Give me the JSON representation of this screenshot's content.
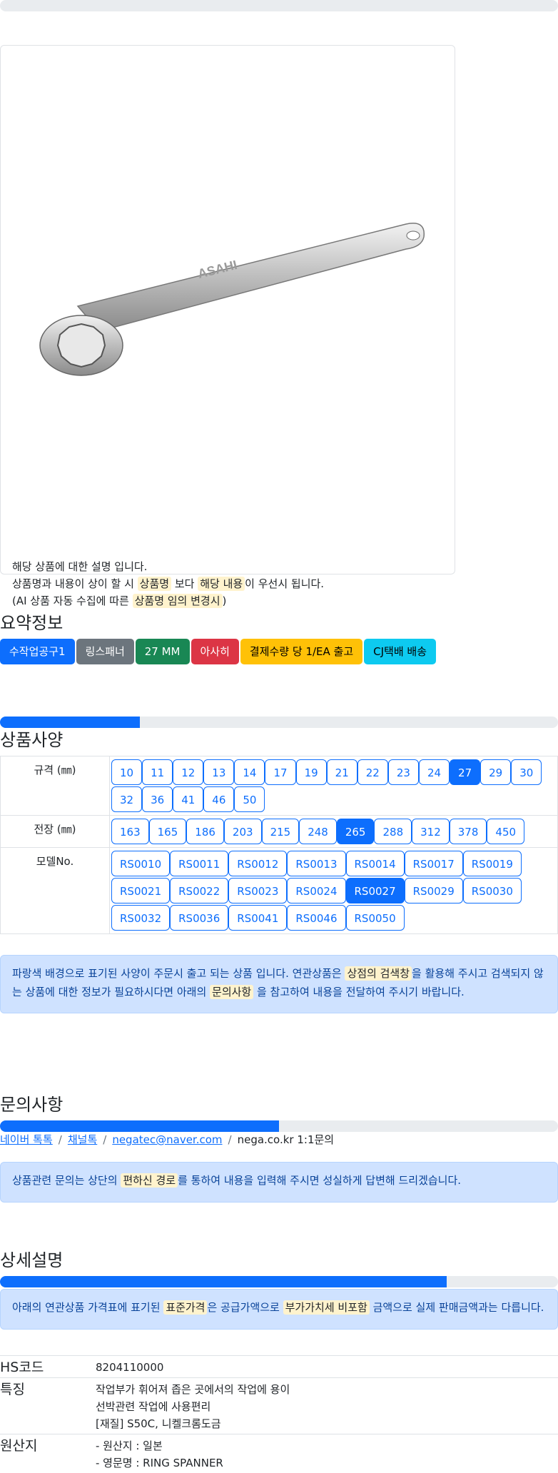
{
  "top_progress_percent": 0,
  "product_card": {
    "image_name": "ring spanner (ASAHI)",
    "brand_mark": "ASAHI",
    "desc_line1": "해당 상품에 대한 설명 입니다.",
    "desc_line2_a": "상품명과 내용이 상이 할 시 ",
    "desc_line2_mark1": "상품명",
    "desc_line2_b": " 보다 ",
    "desc_line2_mark2": "해당 내용",
    "desc_line2_c": "이 우선시 됩니다.",
    "desc_line3_a": "(AI 상품 자동 수집에 따른 ",
    "desc_line3_mark": "상품명 임의 변경시",
    "desc_line3_b": ")"
  },
  "summary": {
    "title": "요약정보",
    "badges": [
      "수작업공구1",
      "링스패너",
      "27 MM",
      "아사히",
      "결제수량 당 1/EA 출고",
      "CJ택배 배송"
    ]
  },
  "spec": {
    "title": "상품사양",
    "progress_percent": 25,
    "rows": [
      {
        "label": "규격 (㎜)",
        "selected": "27",
        "options": [
          "10",
          "11",
          "12",
          "13",
          "14",
          "17",
          "19",
          "21",
          "22",
          "23",
          "24",
          "27",
          "29",
          "30",
          "32",
          "36",
          "41",
          "46",
          "50"
        ]
      },
      {
        "label": "전장 (㎜)",
        "selected": "265",
        "options": [
          "163",
          "165",
          "186",
          "203",
          "215",
          "248",
          "265",
          "288",
          "312",
          "378",
          "450"
        ]
      },
      {
        "label": "모델No.",
        "selected": "RS0027",
        "options": [
          "RS0010",
          "RS0011",
          "RS0012",
          "RS0013",
          "RS0014",
          "RS0017",
          "RS0019",
          "RS0021",
          "RS0022",
          "RS0023",
          "RS0024",
          "RS0027",
          "RS0029",
          "RS0030",
          "RS0032",
          "RS0036",
          "RS0041",
          "RS0046",
          "RS0050"
        ]
      }
    ],
    "notice_a": "파랑색 배경으로 표기된 사양이 주문시 출고 되는 상품 입니다. 연관상품은 ",
    "notice_mark1": "상점의 검색창",
    "notice_b": "을 활용해 주시고 검색되지 않는 상품에 대한 정보가 필요하시다면 아래의 ",
    "notice_mark2": "문의사항",
    "notice_c": " 을 참고하여 내용을 전달하여 주시기 바랍니다."
  },
  "inquiry": {
    "title": "문의사항",
    "progress_percent": 50,
    "links": [
      "네이버 톡톡",
      "채널톡",
      "negatec@naver.com"
    ],
    "plain": "nega.co.kr 1:1문의",
    "separator": "/",
    "notice_a": "상품관련 문의는 상단의 ",
    "notice_mark": "편하신 경로",
    "notice_b": "를 통하여 내용을 입력해 주시면 성실하게 답변해 드리겠습니다."
  },
  "detail": {
    "title": "상세설명",
    "progress_percent": 80,
    "notice_a": "아래의 연관상품 가격표에 표기된 ",
    "notice_mark1": "표준가격",
    "notice_b": "은 공급가액으로 ",
    "notice_mark2": "부가가치세 비포함",
    "notice_c": " 금액으로 실제 판매금액과는 다릅니다.",
    "rows": [
      {
        "key": "HS코드",
        "lines": [
          "8204110000"
        ]
      },
      {
        "key": "특징",
        "lines": [
          "작업부가 휘어져 좁은 곳에서의 작업에 용이",
          "선박관련 작업에 사용편리",
          "[재질] S50C, 니켈크롬도금"
        ]
      },
      {
        "key": "원산지",
        "lines": [
          "- 원산지 : 일본",
          "- 영문명 : RING SPANNER"
        ]
      }
    ]
  }
}
